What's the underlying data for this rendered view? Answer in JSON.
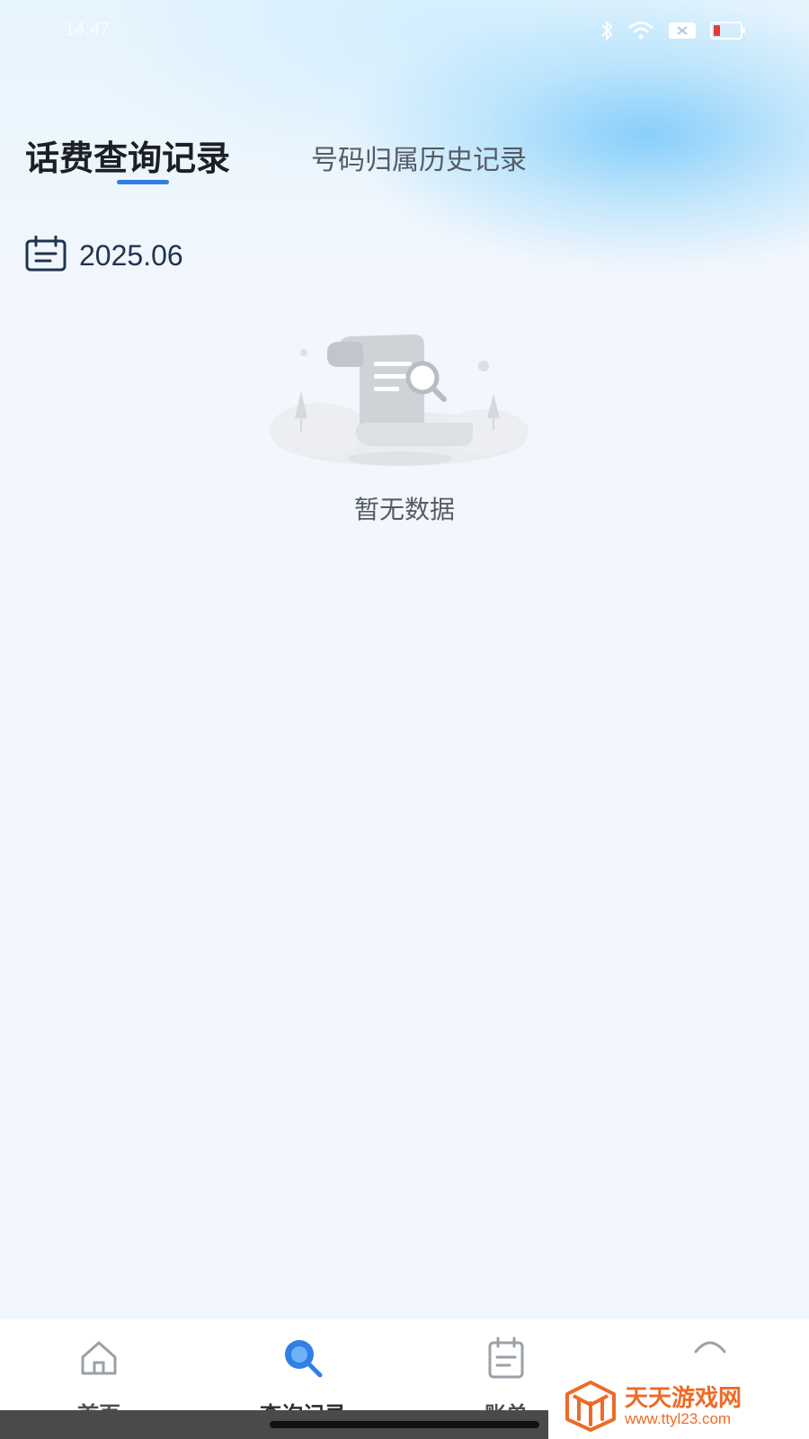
{
  "status_bar": {
    "time": "14:47",
    "icons": [
      "bluetooth-icon",
      "wifi-icon",
      "signal-icon",
      "battery-icon"
    ]
  },
  "tabs": {
    "active_label": "话费查询记录",
    "inactive_label": "号码归属历史记录"
  },
  "date_filter": {
    "value": "2025.06",
    "icon": "calendar-icon"
  },
  "empty_state": {
    "message": "暂无数据",
    "icon": "empty-document-search-icon"
  },
  "tabbar": {
    "items": [
      {
        "label": "首页",
        "icon": "home-icon"
      },
      {
        "label": "查询记录",
        "icon": "search-icon",
        "active": true
      },
      {
        "label": "账单",
        "icon": "bill-icon"
      },
      {
        "label": "",
        "icon": "profile-icon"
      }
    ]
  },
  "watermark": {
    "title": "天天游戏网",
    "url": "www.ttyl23.com"
  },
  "colors": {
    "accent": "#2f7fe5",
    "background": "#f2f6fd",
    "watermark": "#ee6a27"
  }
}
